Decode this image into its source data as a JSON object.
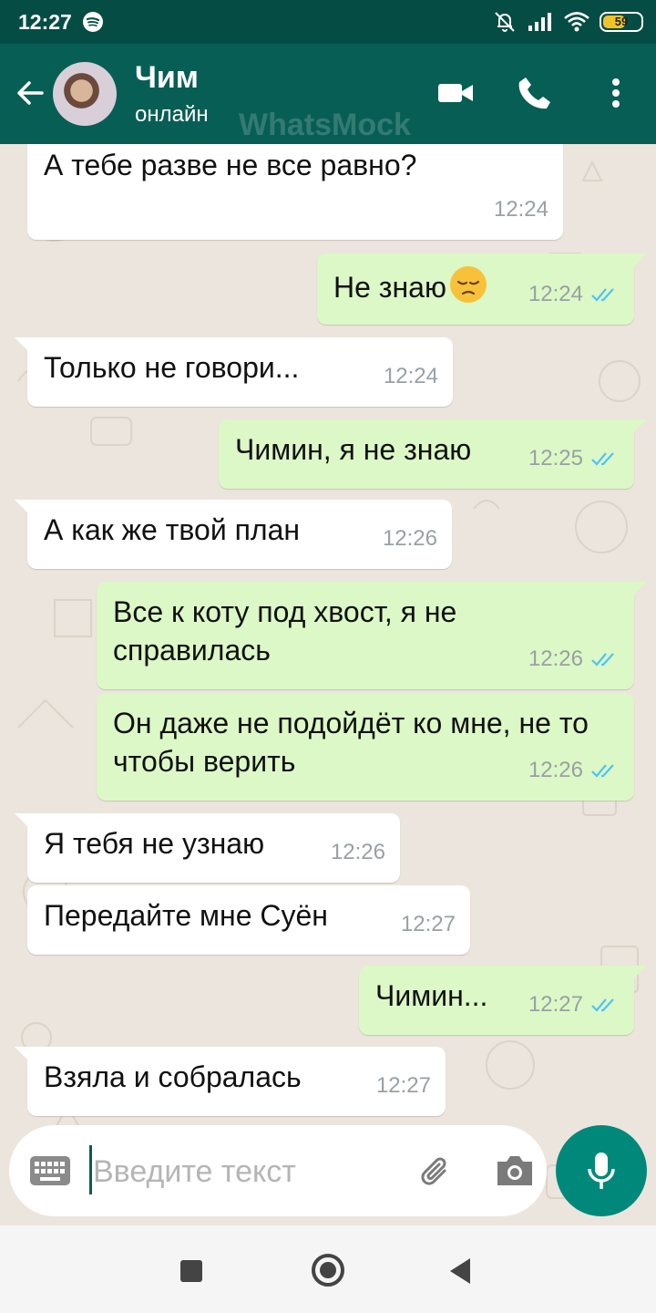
{
  "status_bar": {
    "time": "12:27",
    "battery_level": "59"
  },
  "header": {
    "contact_name": "Чим",
    "contact_status": "онлайн",
    "watermark": "WhatsMock"
  },
  "messages": [
    {
      "direction": "in",
      "text": "А тебе разве не все равно?",
      "time": "12:24"
    },
    {
      "direction": "out",
      "text": "Не знаю",
      "emoji": "pensive-face",
      "time": "12:24",
      "read": true
    },
    {
      "direction": "in",
      "text": "Только не говори...",
      "time": "12:24"
    },
    {
      "direction": "out",
      "text": "Чимин, я не знаю",
      "time": "12:25",
      "read": true
    },
    {
      "direction": "in",
      "text": "А как же твой план",
      "time": "12:26"
    },
    {
      "direction": "out",
      "text": "Все к коту под хвост, я не справилась",
      "time": "12:26",
      "read": true
    },
    {
      "direction": "out",
      "text": "Он даже не подойдёт ко мне, не то чтобы верить",
      "time": "12:26",
      "read": true
    },
    {
      "direction": "in",
      "text": "Я тебя не узнаю",
      "time": "12:26"
    },
    {
      "direction": "in",
      "text": "Передайте мне Суён",
      "time": "12:27"
    },
    {
      "direction": "out",
      "text": "Чимин...",
      "time": "12:27",
      "read": true
    },
    {
      "direction": "in",
      "text": "Взяла и собралась",
      "time": "12:27"
    }
  ],
  "composer": {
    "placeholder": "Введите текст"
  },
  "colors": {
    "header": "#075e54",
    "outgoing_bubble": "#dcf8c6",
    "incoming_bubble": "#ffffff",
    "read_ticks": "#4fc3f7",
    "mic_button": "#00897b"
  }
}
